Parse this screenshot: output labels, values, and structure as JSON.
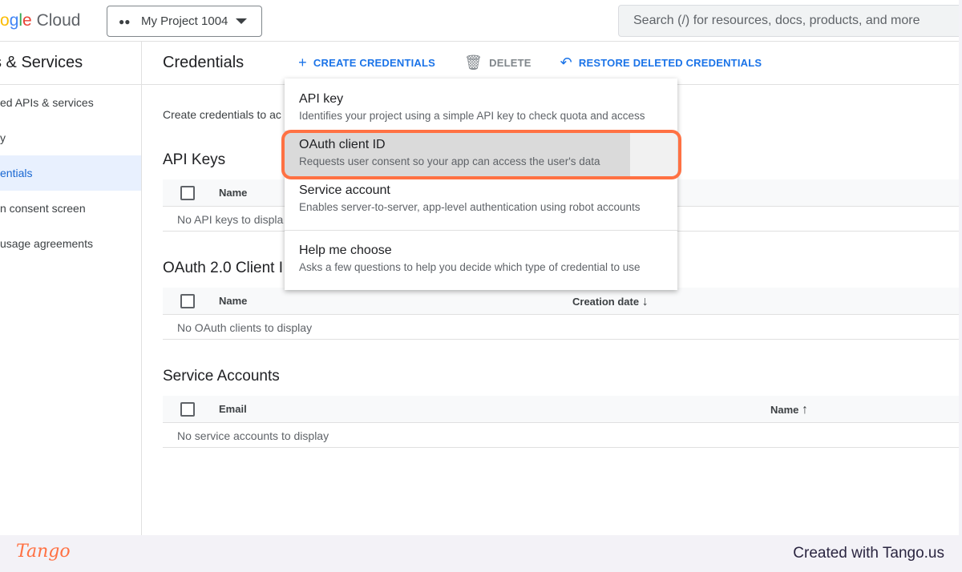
{
  "topbar": {
    "logo": "ogle Cloud",
    "project": "My Project 1004",
    "search_placeholder": "Search (/) for resources, docs, products, and more"
  },
  "sidebar": {
    "title": "s & Services",
    "items": [
      {
        "label": "ed APIs & services"
      },
      {
        "label": "y"
      },
      {
        "label": "entials",
        "active": true
      },
      {
        "label": "n consent screen"
      },
      {
        "label": "usage agreements"
      }
    ]
  },
  "header": {
    "title": "Credentials",
    "create": "CREATE CREDENTIALS",
    "delete": "DELETE",
    "restore": "RESTORE DELETED CREDENTIALS"
  },
  "main": {
    "description": "Create credentials to ac",
    "api_keys": {
      "title": "API Keys",
      "col_name": "Name",
      "empty": "No API keys to displa"
    },
    "oauth": {
      "title": "OAuth 2.0 Client I",
      "col_name": "Name",
      "col_date": "Creation date",
      "empty": "No OAuth clients to display"
    },
    "service": {
      "title": "Service Accounts",
      "col_email": "Email",
      "col_name": "Name",
      "empty": "No service accounts to display"
    }
  },
  "menu": [
    {
      "title": "API key",
      "desc": "Identifies your project using a simple API key to check quota and access"
    },
    {
      "title": "OAuth client ID",
      "desc": "Requests user consent so your app can access the user's data",
      "highlighted": true
    },
    {
      "title": "Service account",
      "desc": "Enables server-to-server, app-level authentication using robot accounts"
    },
    {
      "title": "Help me choose",
      "desc": "Asks a few questions to help you decide which type of credential to use"
    }
  ],
  "footer": {
    "logo": "Tango",
    "credit": "Created with Tango.us"
  },
  "colors": {
    "accent": "#1a73e8",
    "highlight": "#ff7143"
  }
}
